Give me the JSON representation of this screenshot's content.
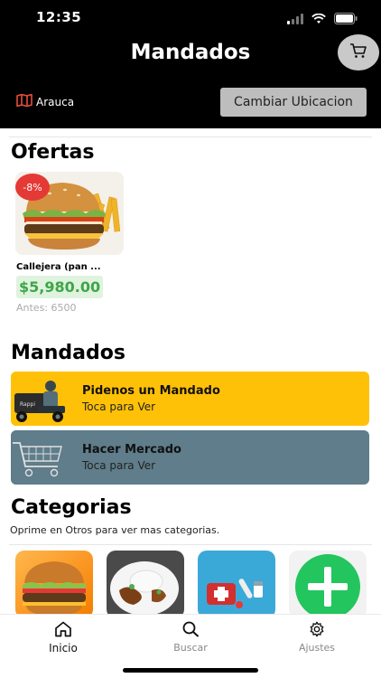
{
  "status_bar": {
    "time": "12:35",
    "icons": [
      "signal-icon",
      "wifi-icon",
      "battery-icon"
    ]
  },
  "header": {
    "title": "Mandados",
    "cart_icon": "cart-icon",
    "location_icon": "map-icon",
    "location": "Arauca",
    "change_location_label": "Cambiar Ubicacion"
  },
  "offers": {
    "title": "Ofertas",
    "items": [
      {
        "discount": "-8%",
        "name": "Callejera (pan ...",
        "price": "$5,980.00",
        "before": "Antes: 6500"
      }
    ]
  },
  "errands": {
    "title": "Mandados",
    "cards": [
      {
        "title": "Pidenos un Mandado",
        "subtitle": "Toca para Ver",
        "color": "#ffc107"
      },
      {
        "title": "Hacer Mercado",
        "subtitle": "Toca para Ver",
        "color": "#5f7d8a"
      }
    ]
  },
  "categories": {
    "title": "Categorias",
    "hint": "Oprime en Otros para ver mas categorias.",
    "tiles": [
      "burger",
      "plated-meal",
      "first-aid-kit",
      "plus-more"
    ]
  },
  "bottom_nav": {
    "items": [
      {
        "label": "Inicio",
        "icon": "home-icon",
        "active": true
      },
      {
        "label": "Buscar",
        "icon": "search-icon",
        "active": false
      },
      {
        "label": "Ajustes",
        "icon": "gear-icon",
        "active": false
      }
    ]
  },
  "colors": {
    "header_bg": "#000000",
    "price_green": "#3fa648",
    "badge_red": "#e53935",
    "accent_yellow": "#ffc107",
    "slate": "#5f7d8a"
  }
}
